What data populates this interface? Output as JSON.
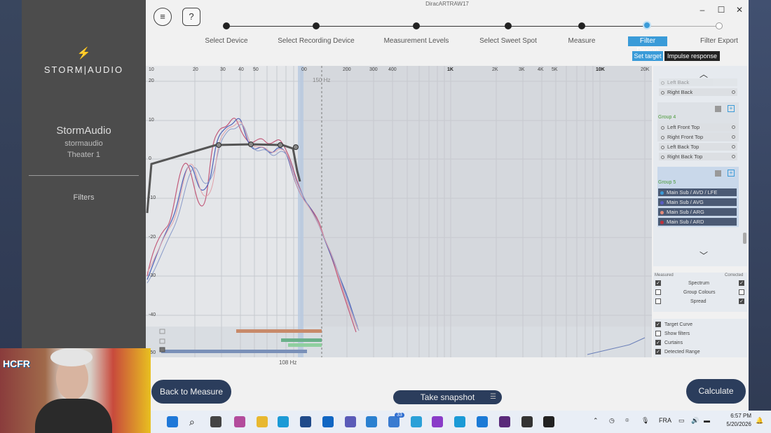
{
  "app": {
    "title": "DiracARTRAW17"
  },
  "sidebar": {
    "logo": "STORM|AUDIO",
    "device_name": "StormAudio",
    "device_sub1": "stormaudio",
    "device_sub2": "Theater 1",
    "section": "Filters"
  },
  "steps": [
    {
      "label": "Select Device"
    },
    {
      "label": "Select Recording Device"
    },
    {
      "label": "Measurement Levels"
    },
    {
      "label": "Select Sweet Spot"
    },
    {
      "label": "Measure"
    },
    {
      "label": "Filter Design"
    },
    {
      "label": "Filter Export"
    }
  ],
  "view_toggle": {
    "set_target": "Set target",
    "impulse": "Impulse response"
  },
  "graph": {
    "x_ticks": [
      "10",
      "20",
      "30",
      "40",
      "50",
      "00",
      "200",
      "300",
      "400",
      "1K",
      "2K",
      "3K",
      "4K",
      "5K",
      "10K",
      "20K"
    ],
    "y_ticks": [
      "10",
      "20",
      "10",
      "0",
      "-10",
      "-20",
      "-30",
      "-40",
      "-50"
    ],
    "marker_top": "150 Hz",
    "marker_bottom": "108 Hz"
  },
  "channels": {
    "partial_top": "Left Back",
    "group3_rows": [
      "Right Back"
    ],
    "group4_label": "Group 4",
    "group4_rows": [
      "Left Front Top",
      "Right Front Top",
      "Left Back Top",
      "Right Back Top"
    ],
    "group5_label": "Group 5",
    "group5_rows": [
      {
        "label": "Main Sub / AVD / LFE",
        "color": "#3a9bd8"
      },
      {
        "label": "Main Sub / AVG",
        "color": "#5a5cc4"
      },
      {
        "label": "Main Sub / ARG",
        "color": "#e48a7a"
      },
      {
        "label": "Main Sub / ARD",
        "color": "#c0303a"
      }
    ]
  },
  "display_options": {
    "measured_header": "Measured",
    "corrected_header": "Corrected",
    "rows": [
      {
        "label": "Spectrum",
        "measured": true,
        "corrected": true
      },
      {
        "label": "Group Colours",
        "measured": false,
        "corrected": false
      },
      {
        "label": "Spread",
        "measured": false,
        "corrected": true
      }
    ],
    "extra": [
      {
        "label": "Target Curve",
        "checked": true
      },
      {
        "label": "Show filters",
        "checked": false
      },
      {
        "label": "Curtains",
        "checked": true
      },
      {
        "label": "Detected Range",
        "checked": true
      }
    ]
  },
  "buttons": {
    "back": "Back to Measure",
    "snapshot": "Take snapshot",
    "calculate": "Calculate"
  },
  "taskbar": {
    "badge": "33",
    "language": "FRA",
    "time": "6:57 PM",
    "date": "5/20/2026"
  },
  "webcam": {
    "logo_text": "HCFR"
  }
}
